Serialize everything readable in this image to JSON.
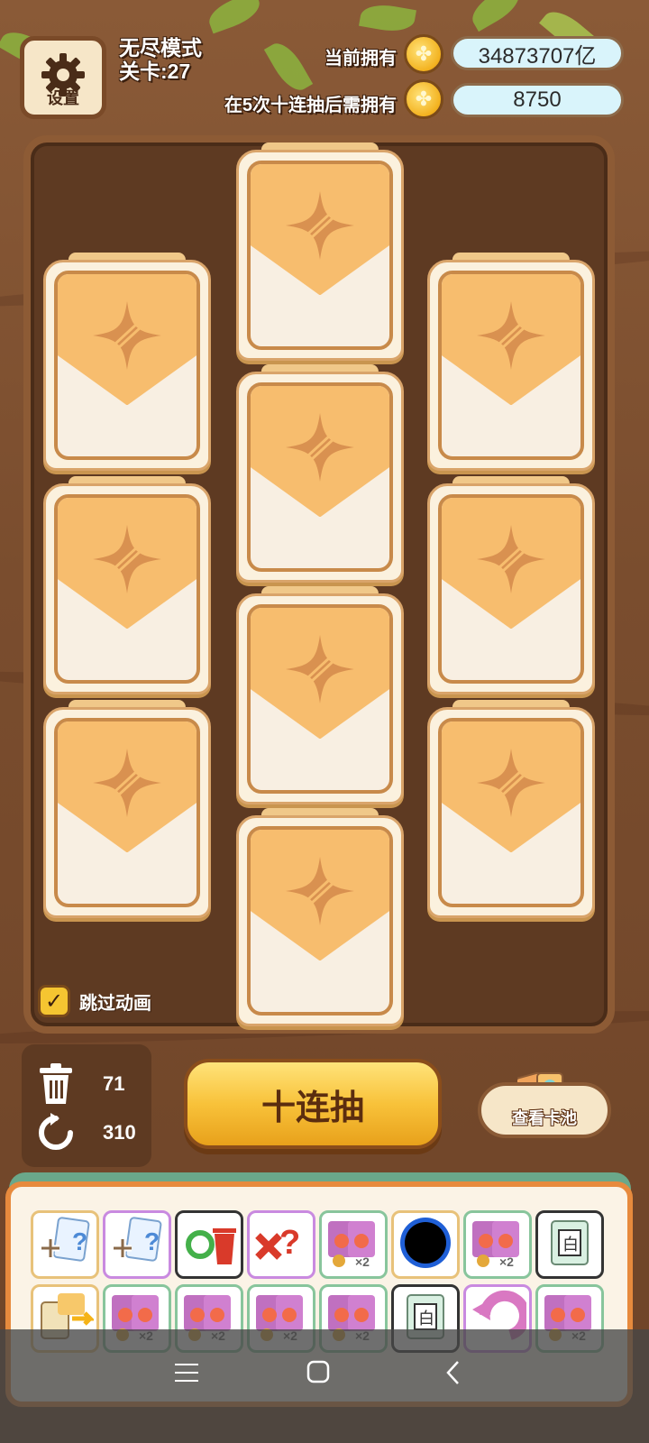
{
  "header": {
    "settings_label": "设置",
    "mode": "无尽模式",
    "level": "关卡:27",
    "owned_label": "当前拥有",
    "owned_value": "34873707亿",
    "required_label": "在5次十连抽后需拥有",
    "required_value": "8750"
  },
  "board": {
    "skip_label": "跳过动画",
    "skip_checked": true
  },
  "stats": {
    "trash_count": "71",
    "refresh_count": "310"
  },
  "actions": {
    "draw_ten_label": "十连抽",
    "view_pool_label": "查看卡池"
  },
  "items": {
    "row1": [
      "add-card-icon",
      "add-card-free-icon",
      "recycle-trash-icon",
      "remove-question-icon",
      "card-pack-x2-icon",
      "black-hole-icon",
      "card-pack-x2-icon",
      "white-frame-card-icon"
    ],
    "row2": [
      "swap-card-icon",
      "card-pack-x2-icon",
      "card-pack-x2-icon",
      "card-pack-x2-icon",
      "card-pack-x2-icon",
      "white-frame-card-icon",
      "undo-arrow-icon",
      "card-pack-x2-icon"
    ],
    "multiplier": "×2",
    "white_char": "白"
  },
  "colors": {
    "wood": "#7a4d2e",
    "card_top": "#f7bd6e",
    "button": "#f8c23a",
    "value_pill": "#d9f4fb"
  }
}
